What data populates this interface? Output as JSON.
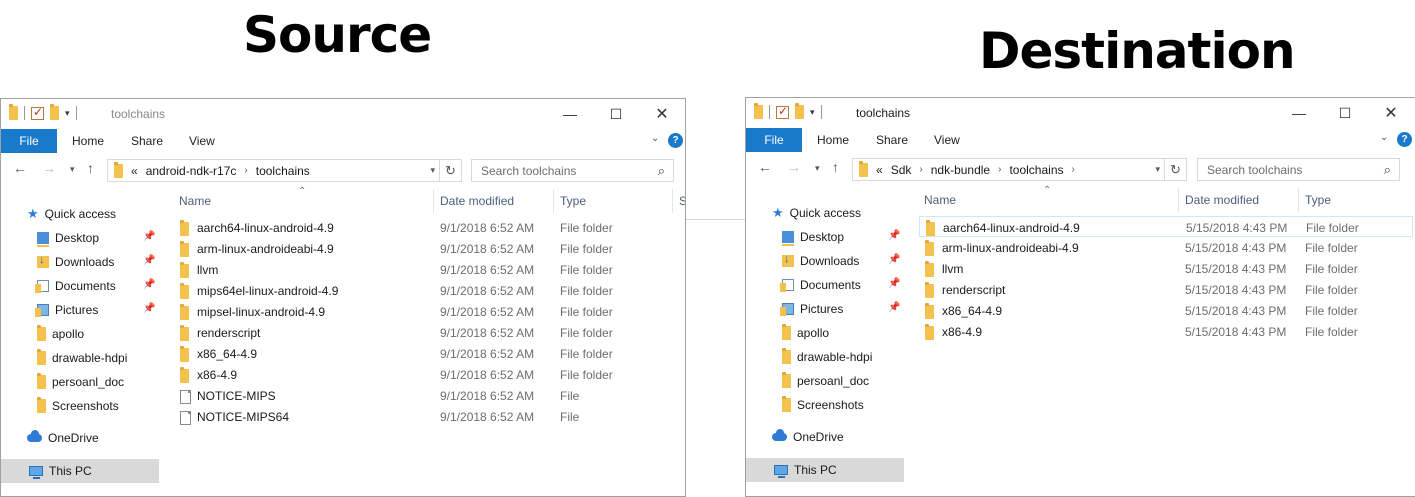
{
  "headings": {
    "source": "Source",
    "destination": "Destination"
  },
  "source": {
    "title": "toolchains",
    "ribbon": {
      "file": "File",
      "tabs": [
        "Home",
        "Share",
        "View"
      ]
    },
    "address": {
      "prefix": "«",
      "parts": [
        "android-ndk-r17c",
        "toolchains"
      ]
    },
    "search_placeholder": "Search toolchains",
    "columns": {
      "name": "Name",
      "date": "Date modified",
      "type": "Type",
      "size_partial": "S"
    },
    "nav": {
      "quick_access": "Quick access",
      "pinned": [
        "Desktop",
        "Downloads",
        "Documents",
        "Pictures"
      ],
      "folders": [
        "apollo",
        "drawable-hdpi",
        "persoanl_doc",
        "Screenshots"
      ],
      "onedrive": "OneDrive",
      "this_pc": "This PC"
    },
    "rows": [
      {
        "name": "aarch64-linux-android-4.9",
        "date": "9/1/2018 6:52 AM",
        "type": "File folder",
        "kind": "folder"
      },
      {
        "name": "arm-linux-androideabi-4.9",
        "date": "9/1/2018 6:52 AM",
        "type": "File folder",
        "kind": "folder"
      },
      {
        "name": "llvm",
        "date": "9/1/2018 6:52 AM",
        "type": "File folder",
        "kind": "folder"
      },
      {
        "name": "mips64el-linux-android-4.9",
        "date": "9/1/2018 6:52 AM",
        "type": "File folder",
        "kind": "folder"
      },
      {
        "name": "mipsel-linux-android-4.9",
        "date": "9/1/2018 6:52 AM",
        "type": "File folder",
        "kind": "folder"
      },
      {
        "name": "renderscript",
        "date": "9/1/2018 6:52 AM",
        "type": "File folder",
        "kind": "folder"
      },
      {
        "name": "x86_64-4.9",
        "date": "9/1/2018 6:52 AM",
        "type": "File folder",
        "kind": "folder"
      },
      {
        "name": "x86-4.9",
        "date": "9/1/2018 6:52 AM",
        "type": "File folder",
        "kind": "folder"
      },
      {
        "name": "NOTICE-MIPS",
        "date": "9/1/2018 6:52 AM",
        "type": "File",
        "kind": "file"
      },
      {
        "name": "NOTICE-MIPS64",
        "date": "9/1/2018 6:52 AM",
        "type": "File",
        "kind": "file"
      }
    ]
  },
  "destination": {
    "title": "toolchains",
    "ribbon": {
      "file": "File",
      "tabs": [
        "Home",
        "Share",
        "View"
      ]
    },
    "address": {
      "prefix": "«",
      "parts": [
        "Sdk",
        "ndk-bundle",
        "toolchains"
      ]
    },
    "search_placeholder": "Search toolchains",
    "columns": {
      "name": "Name",
      "date": "Date modified",
      "type": "Type"
    },
    "nav": {
      "quick_access": "Quick access",
      "pinned": [
        "Desktop",
        "Downloads",
        "Documents",
        "Pictures"
      ],
      "folders": [
        "apollo",
        "drawable-hdpi",
        "persoanl_doc",
        "Screenshots"
      ],
      "onedrive": "OneDrive",
      "this_pc": "This PC"
    },
    "rows": [
      {
        "name": "aarch64-linux-android-4.9",
        "date": "5/15/2018 4:43 PM",
        "type": "File folder",
        "kind": "folder"
      },
      {
        "name": "arm-linux-androideabi-4.9",
        "date": "5/15/2018 4:43 PM",
        "type": "File folder",
        "kind": "folder"
      },
      {
        "name": "llvm",
        "date": "5/15/2018 4:43 PM",
        "type": "File folder",
        "kind": "folder"
      },
      {
        "name": "renderscript",
        "date": "5/15/2018 4:43 PM",
        "type": "File folder",
        "kind": "folder"
      },
      {
        "name": "x86_64-4.9",
        "date": "5/15/2018 4:43 PM",
        "type": "File folder",
        "kind": "folder"
      },
      {
        "name": "x86-4.9",
        "date": "5/15/2018 4:43 PM",
        "type": "File folder",
        "kind": "folder"
      }
    ]
  },
  "colors": {
    "accent": "#1979ca",
    "folder": "#f4c14c",
    "selection": "#d9d9d9",
    "header_text": "#4c607a"
  }
}
